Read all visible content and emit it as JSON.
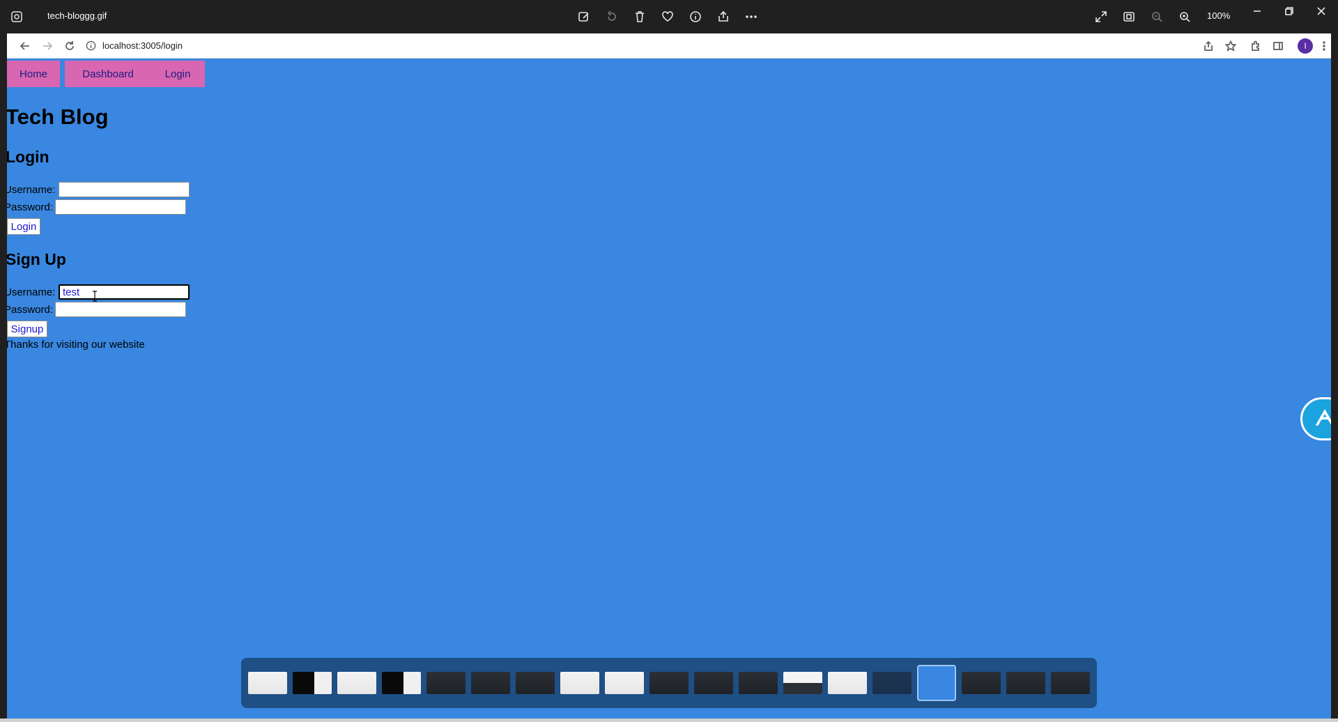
{
  "viewer": {
    "file_name": "tech-bloggg.gif",
    "zoom_level": "100%"
  },
  "browser": {
    "url": "localhost:3005/login",
    "avatar_letter": "I"
  },
  "nav": {
    "home": "Home",
    "dashboard": "Dashboard",
    "login": "Login"
  },
  "site_title": "Tech Blog",
  "login_form": {
    "heading": "Login",
    "username_label": "Username:",
    "password_label": "Password:",
    "username_value": "",
    "password_value": "",
    "submit_label": "Login"
  },
  "signup_form": {
    "heading": "Sign Up",
    "username_label": "Username:",
    "password_label": "Password:",
    "username_value": "test",
    "password_value": "",
    "submit_label": "Signup"
  },
  "footer_text": "Thanks for visiting our website",
  "colors": {
    "page_background": "#3987e0",
    "nav_link_background": "#d966b0",
    "filmstrip_background": "#1e4f85"
  },
  "filmstrip": {
    "thumbnails": [
      "light",
      "dark-light",
      "light",
      "dark-light",
      "dark",
      "dark",
      "dark",
      "light",
      "light",
      "dark",
      "dark",
      "dark",
      "light-dark",
      "light",
      "dark-blue",
      "blue-selected",
      "dark",
      "dark",
      "dark"
    ],
    "selected_index": 15
  }
}
